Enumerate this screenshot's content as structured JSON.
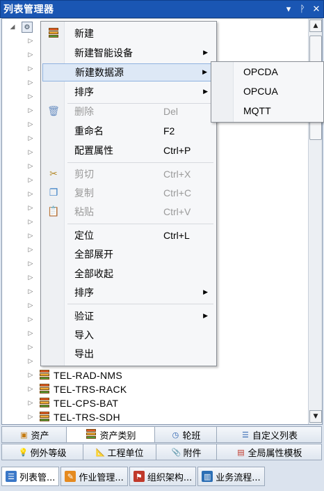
{
  "window": {
    "title": "列表管理器",
    "controls": [
      "▾",
      "ᵩ",
      "✕"
    ]
  },
  "tree": {
    "root_expander": "◢",
    "root_icon": "⚙",
    "items": [
      {
        "label": "TEL-RAD-NMS"
      },
      {
        "label": "TEL-TRS-RACK"
      },
      {
        "label": "TEL-CPS-BAT"
      },
      {
        "label": "TEL-TRS-SDH"
      }
    ]
  },
  "context_menu": {
    "items": [
      {
        "label": "新建",
        "shortcut": "",
        "icon": "book-stack-icon",
        "submenu": false,
        "disabled": false
      },
      {
        "label": "新建智能设备",
        "shortcut": "",
        "icon": "",
        "submenu": true,
        "disabled": false
      },
      {
        "label": "新建数据源",
        "shortcut": "",
        "icon": "",
        "submenu": true,
        "disabled": false,
        "highlighted": true
      },
      {
        "label": "排序",
        "shortcut": "",
        "icon": "",
        "submenu": true,
        "disabled": false
      },
      {
        "label": "删除",
        "shortcut": "Del",
        "icon": "trash-icon",
        "submenu": false,
        "disabled": true
      },
      {
        "label": "重命名",
        "shortcut": "F2",
        "icon": "",
        "submenu": false,
        "disabled": false
      },
      {
        "label": "配置属性",
        "shortcut": "Ctrl+P",
        "icon": "",
        "submenu": false,
        "disabled": false
      },
      {
        "label": "剪切",
        "shortcut": "Ctrl+X",
        "icon": "scissors-icon",
        "submenu": false,
        "disabled": true
      },
      {
        "label": "复制",
        "shortcut": "Ctrl+C",
        "icon": "copy-icon",
        "submenu": false,
        "disabled": true
      },
      {
        "label": "粘贴",
        "shortcut": "Ctrl+V",
        "icon": "paste-icon",
        "submenu": false,
        "disabled": true
      },
      {
        "label": "定位",
        "shortcut": "Ctrl+L",
        "icon": "",
        "submenu": false,
        "disabled": false
      },
      {
        "label": "全部展开",
        "shortcut": "",
        "icon": "",
        "submenu": false,
        "disabled": false
      },
      {
        "label": "全部收起",
        "shortcut": "",
        "icon": "",
        "submenu": false,
        "disabled": false
      },
      {
        "label": "排序",
        "shortcut": "",
        "icon": "",
        "submenu": true,
        "disabled": false
      },
      {
        "label": "验证",
        "shortcut": "",
        "icon": "",
        "submenu": true,
        "disabled": false
      },
      {
        "label": "导入",
        "shortcut": "",
        "icon": "",
        "submenu": false,
        "disabled": false
      },
      {
        "label": "导出",
        "shortcut": "",
        "icon": "",
        "submenu": false,
        "disabled": false
      }
    ]
  },
  "submenu": {
    "items": [
      "OPCDA",
      "OPCUA",
      "MQTT"
    ]
  },
  "tabs_row1": [
    {
      "label": "资产",
      "icon": "asset-icon",
      "active": false
    },
    {
      "label": "资产类别",
      "icon": "book-stack-icon",
      "active": true
    },
    {
      "label": "轮班",
      "icon": "clock-icon",
      "active": false
    },
    {
      "label": "自定义列表",
      "icon": "list-icon",
      "active": false
    }
  ],
  "tabs_row2": [
    {
      "label": "例外等级",
      "icon": "bulb-icon",
      "active": false
    },
    {
      "label": "工程单位",
      "icon": "ruler-icon",
      "active": false
    },
    {
      "label": "附件",
      "icon": "paperclip-icon",
      "active": false
    },
    {
      "label": "全局属性模板",
      "icon": "template-icon",
      "active": false
    }
  ],
  "bottom_tabs": [
    {
      "label": "列表管...",
      "icon": "list-manager-icon",
      "active": true,
      "color": "#3b78c8"
    },
    {
      "label": "作业管理...",
      "icon": "job-icon",
      "active": false,
      "color": "#e58a1f"
    },
    {
      "label": "组织架构...",
      "icon": "org-icon",
      "active": false,
      "color": "#c0392b"
    },
    {
      "label": "业务流程...",
      "icon": "workflow-icon",
      "active": false,
      "color": "#2c6fb5"
    }
  ]
}
